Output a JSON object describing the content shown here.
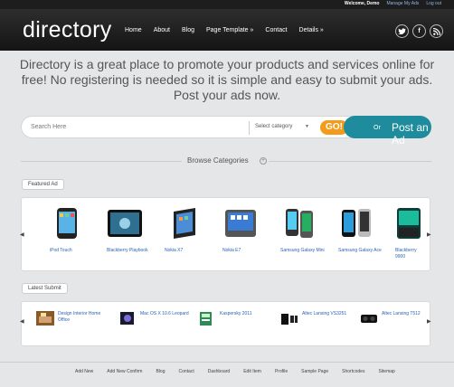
{
  "topbar": {
    "welcome": "Welcome, Demo",
    "manage": "Manage My Ads",
    "logout": "Log out"
  },
  "header": {
    "logo": "directory",
    "nav": [
      "Home",
      "About",
      "Blog",
      "Page Template »",
      "Contact",
      "Details »"
    ],
    "social_icons": [
      "twitter-icon",
      "facebook-icon",
      "rss-icon"
    ]
  },
  "tagline": "Directory is a great place to promote your products and services online for free! No registering is needed so it is simple and easy to submit your ads. Post your ads now.",
  "search": {
    "placeholder": "Search Here",
    "category": "Select category",
    "go": "GO!",
    "or": "Or",
    "post_ad": "Post an Ad"
  },
  "browse": {
    "label": "Browse Categories"
  },
  "featured": {
    "tag": "Featured Ad",
    "items": [
      {
        "name": "iPod Touch"
      },
      {
        "name": "Blackberry Playbook"
      },
      {
        "name": "Nokia X7"
      },
      {
        "name": "Nokia E7"
      },
      {
        "name": "Samsung Galaxy Mini"
      },
      {
        "name": "Samsung Galaxy Ace"
      },
      {
        "name": "Blackberry 9900"
      }
    ]
  },
  "latest": {
    "tag": "Latest Submit",
    "items": [
      {
        "name": "Design Interior Home Office"
      },
      {
        "name": "Mac OS X 10.6 Leopard"
      },
      {
        "name": "Kaspersky 2011"
      },
      {
        "name": "Altec Lansing VS3251"
      },
      {
        "name": "Altec Lansing T512"
      }
    ]
  },
  "footer": [
    "Add New",
    "Add New Confirm",
    "Blog",
    "Contact",
    "Dashboard",
    "Edit Item",
    "Profile",
    "Sample Page",
    "Shortcodes",
    "Sitemap"
  ],
  "colors": {
    "go": "#f49b1b",
    "post": "#1e8c9c",
    "link": "#2b63b5",
    "header": "#1d1d1d"
  }
}
